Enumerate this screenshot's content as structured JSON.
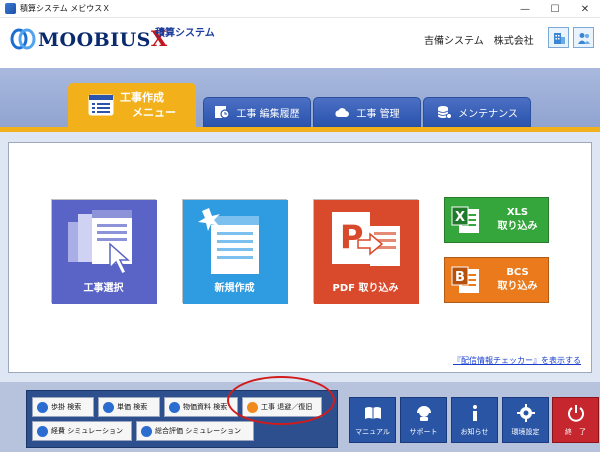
{
  "window": {
    "title": "積算システム メビウスＸ",
    "controls": {
      "minimize": "—",
      "maximize": "☐",
      "close": "✕"
    }
  },
  "header": {
    "logo_main": "MOOBIUS",
    "logo_x": "X",
    "subtitle": "積算システム",
    "company": "吉備システム　株式会社",
    "icons": [
      "building-icon",
      "users-icon"
    ]
  },
  "tabs": [
    {
      "line1": "工事作成",
      "line2": "メニュー",
      "icon": "menu-list-icon",
      "active": true
    },
    {
      "label": "工事 編集履歴",
      "icon": "history-clock-icon",
      "active": false
    },
    {
      "label": "工事 管理",
      "icon": "cloud-icon",
      "active": false
    },
    {
      "label": "メンテナンス",
      "icon": "database-gear-icon",
      "active": false
    }
  ],
  "tiles": [
    {
      "label": "工事選択",
      "color": "#5a64c6",
      "icon": "document-select-icon"
    },
    {
      "label": "新規作成",
      "color": "#2f9be0",
      "icon": "new-document-icon"
    },
    {
      "label": "PDF 取り込み",
      "color": "#d94a2c",
      "icon": "pdf-import-icon"
    }
  ],
  "import_tiles": [
    {
      "line1": "XLS",
      "line2": "取り込み",
      "color": "#35a63c",
      "icon": "excel-icon"
    },
    {
      "line1": "BCS",
      "line2": "取り込み",
      "color": "#ea7a1c",
      "icon": "bcs-icon"
    }
  ],
  "checker_link": "『配信情報チェッカー』を表示する",
  "quick_buttons": [
    {
      "label": "歩掛 検索",
      "icon": "search-icon"
    },
    {
      "label": "単価 検索",
      "icon": "search-icon"
    },
    {
      "label": "物価資料 検索",
      "icon": "search-icon"
    },
    {
      "label": "工事 退避／復旧",
      "icon": "database-icon"
    },
    {
      "label": "経費 シミュレーション",
      "icon": "simulation-icon"
    },
    {
      "label": "総合評価 シミュレーション",
      "icon": "simulation-icon"
    }
  ],
  "function_buttons": [
    {
      "label": "マニュアル",
      "icon": "book-icon"
    },
    {
      "label": "サポート",
      "icon": "headset-icon"
    },
    {
      "label": "お知らせ",
      "icon": "info-icon"
    },
    {
      "label": "環境設定",
      "icon": "gear-icon"
    },
    {
      "label": "終　了",
      "icon": "power-icon"
    }
  ],
  "colors": {
    "accent": "#f2b01b",
    "tab_blue": "#2b54ad",
    "highlight_ellipse": "#d01c1c"
  }
}
